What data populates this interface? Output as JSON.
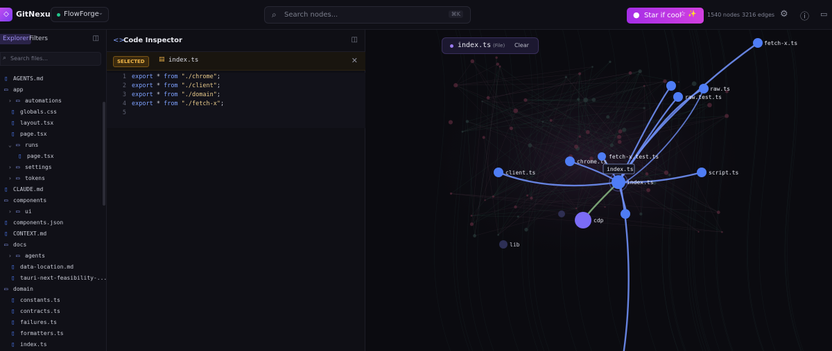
{
  "app": {
    "name": "GitNexus",
    "logo_icon": "nexus-logo-icon"
  },
  "project": {
    "name": "FlowForge"
  },
  "search": {
    "placeholder": "Search nodes...",
    "shortcut": "⌘K"
  },
  "star_button": {
    "label": "Star if cool"
  },
  "stats": {
    "nodes": "1540 nodes",
    "edges": "3216 edges"
  },
  "sidebar": {
    "tabs": [
      "Explorer",
      "Filters"
    ],
    "file_search_placeholder": "Search files...",
    "tree": [
      {
        "name": "AGENTS.md",
        "type": "file",
        "depth": 0
      },
      {
        "name": "app",
        "type": "folder",
        "depth": 0,
        "open": true
      },
      {
        "name": "automations",
        "type": "folder",
        "depth": 1,
        "open": false
      },
      {
        "name": "globals.css",
        "type": "file",
        "depth": 1
      },
      {
        "name": "layout.tsx",
        "type": "file",
        "depth": 1
      },
      {
        "name": "page.tsx",
        "type": "file",
        "depth": 1
      },
      {
        "name": "runs",
        "type": "folder",
        "depth": 1,
        "open": true
      },
      {
        "name": "page.tsx",
        "type": "file",
        "depth": 2
      },
      {
        "name": "settings",
        "type": "folder",
        "depth": 1,
        "open": false
      },
      {
        "name": "tokens",
        "type": "folder",
        "depth": 1,
        "open": false
      },
      {
        "name": "CLAUDE.md",
        "type": "file",
        "depth": 0
      },
      {
        "name": "components",
        "type": "folder",
        "depth": 0,
        "open": true
      },
      {
        "name": "ui",
        "type": "folder",
        "depth": 1,
        "open": false
      },
      {
        "name": "components.json",
        "type": "file",
        "depth": 0
      },
      {
        "name": "CONTEXT.md",
        "type": "file",
        "depth": 0
      },
      {
        "name": "docs",
        "type": "folder",
        "depth": 0,
        "open": true
      },
      {
        "name": "agents",
        "type": "folder",
        "depth": 1,
        "open": false
      },
      {
        "name": "data-location.md",
        "type": "file",
        "depth": 1
      },
      {
        "name": "tauri-next-feasibility-...",
        "type": "file",
        "depth": 1
      },
      {
        "name": "domain",
        "type": "folder",
        "depth": 0,
        "open": true
      },
      {
        "name": "constants.ts",
        "type": "file",
        "depth": 1
      },
      {
        "name": "contracts.ts",
        "type": "file",
        "depth": 1
      },
      {
        "name": "failures.ts",
        "type": "file",
        "depth": 1
      },
      {
        "name": "formatters.ts",
        "type": "file",
        "depth": 1
      },
      {
        "name": "index.ts",
        "type": "file",
        "depth": 1
      }
    ]
  },
  "inspector": {
    "title": "Code Inspector",
    "selected_badge": "SELECTED",
    "file": "index.ts",
    "lines": [
      {
        "n": "1",
        "kw1": "export",
        "op": " * ",
        "kw2": "from",
        "str": " \"./chrome\"",
        "end": ";"
      },
      {
        "n": "2",
        "kw1": "export",
        "op": " * ",
        "kw2": "from",
        "str": " \"./client\"",
        "end": ";"
      },
      {
        "n": "3",
        "kw1": "export",
        "op": " * ",
        "kw2": "from",
        "str": " \"./domain\"",
        "end": ";"
      },
      {
        "n": "4",
        "kw1": "export",
        "op": " * ",
        "kw2": "from",
        "str": " \"./fetch-x\"",
        "end": ";"
      },
      {
        "n": "5",
        "kw1": "",
        "op": "",
        "kw2": "",
        "str": "",
        "end": ""
      }
    ]
  },
  "graph": {
    "selection": {
      "name": "index.ts",
      "type": "(File)",
      "clear_label": "Clear"
    },
    "tooltip": "index.ts",
    "edge_color": "#6f8ff5",
    "node_color": "#4f7df5",
    "nodes": [
      {
        "label": "fetch-x.ts"
      },
      {
        "label": "raw.ts"
      },
      {
        "label": "raw.test.ts"
      },
      {
        "label": "chrome.ts"
      },
      {
        "label": "fetch-x.test.ts"
      },
      {
        "label": "client.ts"
      },
      {
        "label": "script.ts"
      },
      {
        "label": "index.ts"
      },
      {
        "label": "cdp"
      },
      {
        "label": "lib"
      }
    ]
  }
}
